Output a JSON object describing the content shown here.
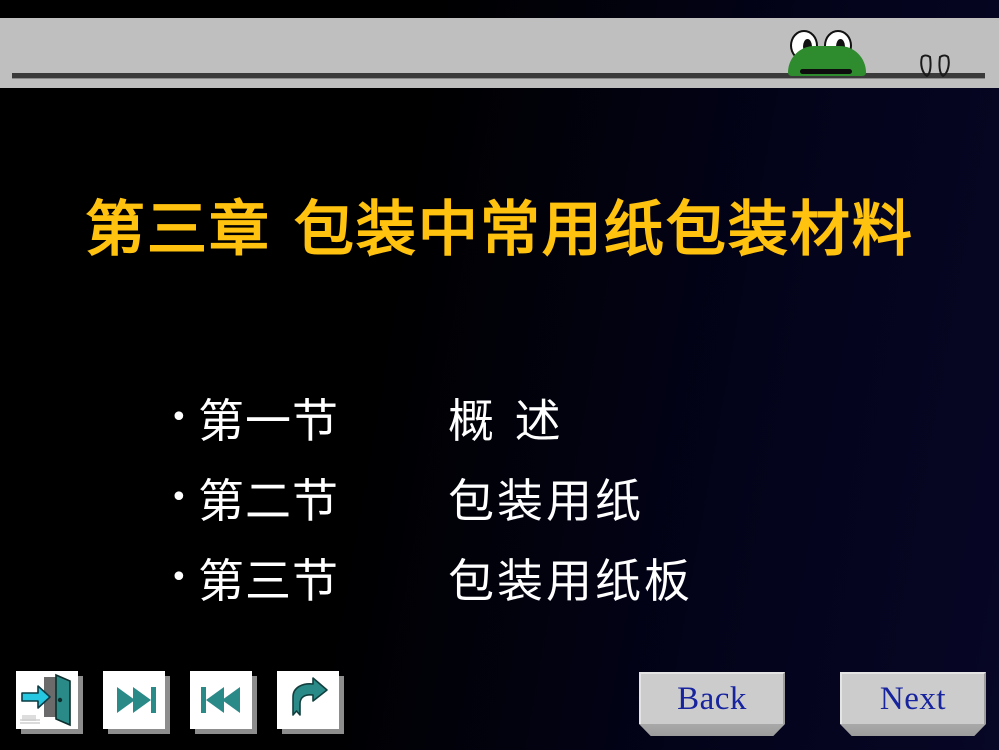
{
  "slide": {
    "title": "第三章  包装中常用纸包装材料",
    "bullets": [
      {
        "marker": "•",
        "label": "第一节",
        "value": "概  述"
      },
      {
        "marker": "•",
        "label": "第二节",
        "value": "包装用纸"
      },
      {
        "marker": "•",
        "label": "第三节",
        "value": "包装用纸板"
      }
    ]
  },
  "banner": {
    "frog_icon": "frog-icon",
    "wing_icon": "wing-icon"
  },
  "nav": {
    "icons": [
      {
        "name": "exit-icon",
        "tip": "Exit"
      },
      {
        "name": "last-slide-icon",
        "tip": "Last"
      },
      {
        "name": "first-slide-icon",
        "tip": "First"
      },
      {
        "name": "return-icon",
        "tip": "Return"
      }
    ],
    "back_label": "Back",
    "next_label": "Next"
  },
  "colors": {
    "title": "#ffc20e",
    "body_text": "#ffffff",
    "button_text": "#17249e",
    "banner": "#bfbfbf",
    "frog_green": "#2e8b2e",
    "icon_teal": "#2a8a88",
    "background_left": "#000000",
    "background_right": "#070726"
  }
}
